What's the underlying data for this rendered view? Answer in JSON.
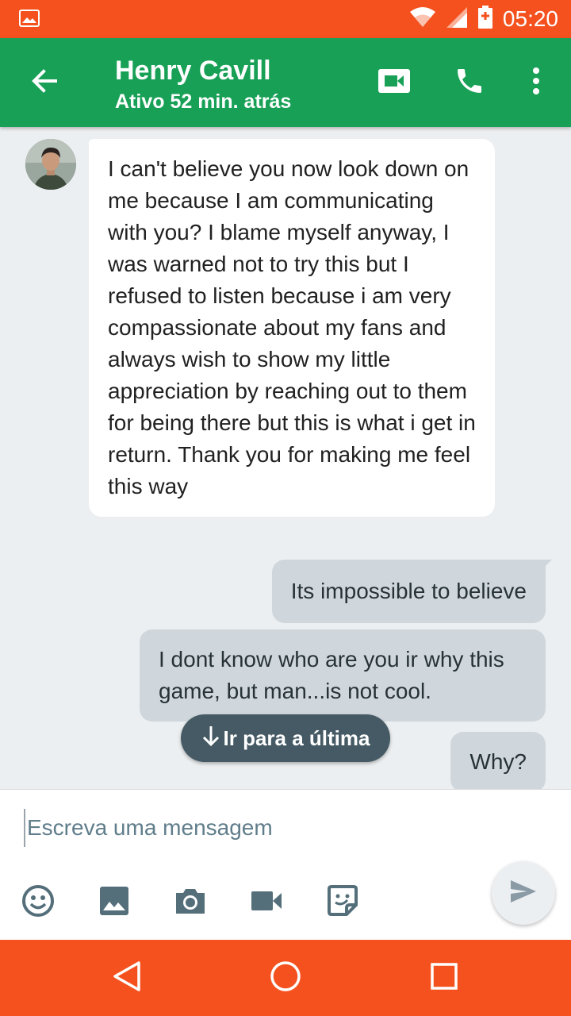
{
  "status_bar": {
    "time": "05:20",
    "icons": [
      "image-icon",
      "wifi-icon",
      "signal-icon",
      "battery-icon"
    ],
    "color": "#F4511E"
  },
  "app_bar": {
    "contact_name": "Henry Cavill",
    "contact_status": "Ativo 52 min. atrás",
    "color": "#17A056",
    "icons": [
      "back-arrow-icon",
      "video-camera-icon",
      "phone-icon",
      "more-vert-icon"
    ]
  },
  "messages": [
    {
      "direction": "incoming",
      "text": "I can't believe you now look down on me because I am communicating with you? I blame myself anyway, I was warned not to try this but I refused to listen because i am very compassionate about my fans and always wish to show my little appreciation by reaching out to them for being there but this is what i get in return. Thank you for making me feel this way"
    },
    {
      "direction": "outgoing",
      "text": "Its impossible to believe"
    },
    {
      "direction": "outgoing",
      "text": "I dont know who are you ir why this game, but man...is not cool."
    },
    {
      "direction": "outgoing",
      "text": "Why?"
    }
  ],
  "jump_button": {
    "label": "Ir para a última",
    "icon": "arrow-down-icon"
  },
  "composer": {
    "placeholder": "Escreva uma mensagem",
    "value": "",
    "tools": [
      "emoji-icon",
      "image-icon",
      "camera-icon",
      "video-icon",
      "sticker-icon"
    ],
    "send_icon": "send-icon"
  },
  "nav_bar": {
    "buttons": [
      "back-triangle-icon",
      "home-circle-icon",
      "recents-square-icon"
    ],
    "color": "#F4511E"
  }
}
